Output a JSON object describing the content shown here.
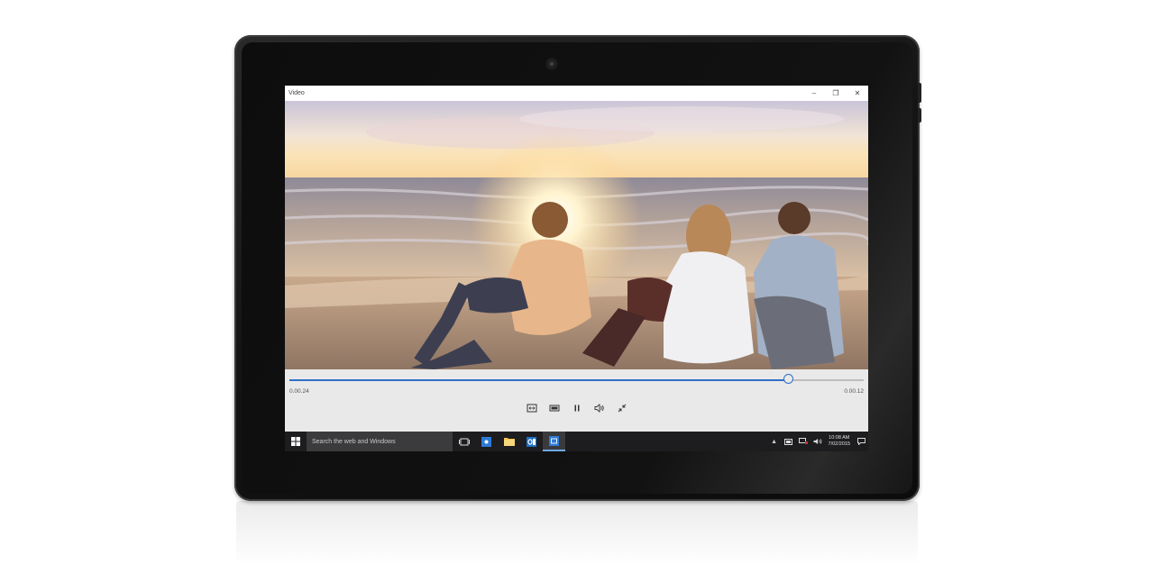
{
  "window": {
    "title": "Video",
    "minimize_glyph": "–",
    "restore_glyph": "❐",
    "close_glyph": "✕"
  },
  "player": {
    "elapsed": "0.00.24",
    "remaining": "0.00.12",
    "progress": 0.87,
    "controls": [
      "cast-icon",
      "aspect-ratio-icon",
      "pause-icon",
      "volume-icon",
      "exit-fullscreen-icon"
    ]
  },
  "taskbar": {
    "search_placeholder": "Search the web and Windows",
    "time": "10:08 AM",
    "date": "7/02/2015",
    "apps": [
      "task-view-icon",
      "store-icon",
      "file-explorer-icon",
      "outlook-icon",
      "video-app-icon"
    ]
  },
  "colors": {
    "accent": "#2f6fc7",
    "taskbar": "#1d1d1f",
    "controls_bg": "#e9e9e9"
  }
}
